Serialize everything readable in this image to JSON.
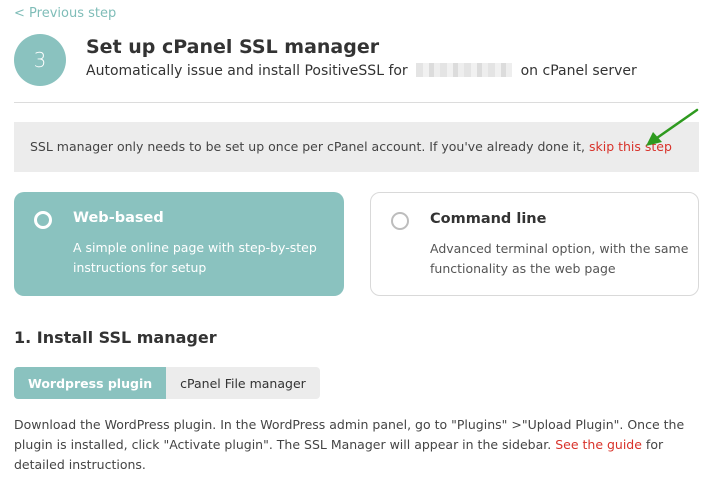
{
  "nav": {
    "previous_label": "< Previous step"
  },
  "header": {
    "step_number": "3",
    "title": "Set up cPanel SSL manager",
    "subtitle_before": "Automatically issue and install PositiveSSL for",
    "subtitle_after": "on cPanel server"
  },
  "note": {
    "text": "SSL manager only needs to be set up once per cPanel account. If you've already done it,",
    "link_label": "skip this step"
  },
  "options": [
    {
      "title": "Web-based",
      "description": "A simple online page with step-by-step instructions for setup",
      "selected": true
    },
    {
      "title": "Command line",
      "description": "Advanced terminal option, with the same functionality as the web page",
      "selected": false
    }
  ],
  "install": {
    "section_title": "1. Install SSL manager",
    "tabs": [
      {
        "label": "Wordpress plugin",
        "active": true
      },
      {
        "label": "cPanel File manager",
        "active": false
      }
    ],
    "instructions_text": "Download the WordPress plugin. In the WordPress admin panel, go to \"Plugins\" >\"Upload Plugin\". Once the plugin is installed, click \"Activate plugin\". The SSL Manager will appear in the sidebar.",
    "guide_link_label": "See the guide",
    "instructions_tail": "for detailed instructions."
  },
  "colors": {
    "accent": "#8ac2bf",
    "link_red": "#d8322a",
    "arrow_green": "#2e9a1f",
    "note_background": "#ececec"
  }
}
